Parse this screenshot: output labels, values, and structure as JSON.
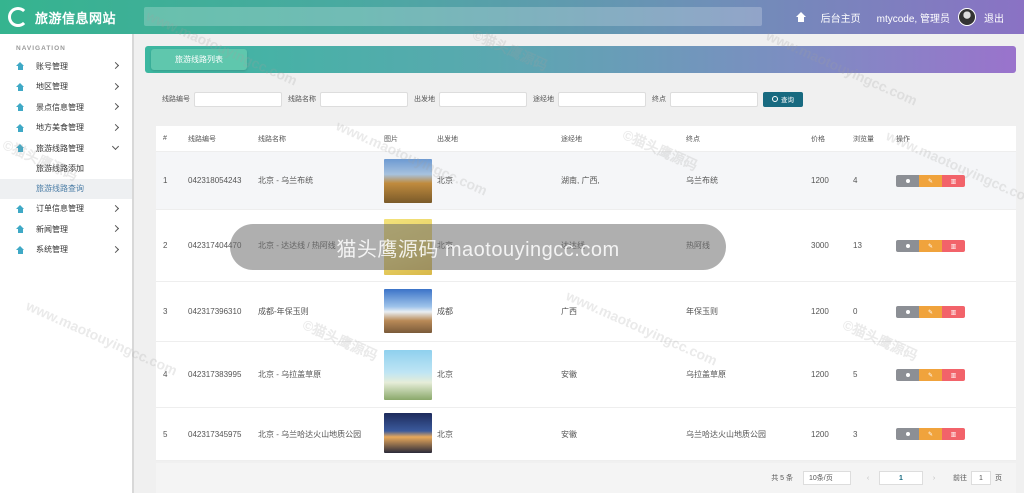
{
  "header": {
    "title": "旅游信息网站",
    "home_label": "后台主页",
    "user_label": "mtycode, 管理员",
    "logout_label": "退出"
  },
  "sidebar": {
    "nav_title": "NAVIGATION",
    "items": [
      {
        "label": "账号管理",
        "has_children": true
      },
      {
        "label": "地区管理",
        "has_children": true
      },
      {
        "label": "景点信息管理",
        "has_children": true
      },
      {
        "label": "地方美食管理",
        "has_children": true
      },
      {
        "label": "旅游线路管理",
        "has_children": true,
        "open": true
      }
    ],
    "sub_items": [
      {
        "label": "旅游线路添加",
        "active": false
      },
      {
        "label": "旅游线路查询",
        "active": true
      }
    ],
    "items_after": [
      {
        "label": "订单信息管理"
      },
      {
        "label": "新闻管理"
      },
      {
        "label": "系统管理"
      }
    ]
  },
  "tab": {
    "label": "旅游线路列表"
  },
  "search": {
    "fields": [
      "线路编号",
      "线路名称",
      "出发地",
      "途经地",
      "终点"
    ],
    "button_label": "查询"
  },
  "table": {
    "headers": [
      "#",
      "线路编号",
      "线路名称",
      "图片",
      "出发地",
      "途经地",
      "终点",
      "价格",
      "浏览量",
      "操作"
    ],
    "rows": [
      {
        "index": "1",
        "code": "042318054243",
        "name": "北京 - 乌兰布统",
        "from": "北京",
        "via": "湖南, 广西,",
        "to": "乌兰布统",
        "price": "1200",
        "views": "4"
      },
      {
        "index": "2",
        "code": "042317404470",
        "name": "北京 - 达达线 / 热阿线",
        "from": "北京",
        "via": "达达线",
        "to": "热阿线",
        "price": "3000",
        "views": "13"
      },
      {
        "index": "3",
        "code": "042317396310",
        "name": "成都-年保玉则",
        "from": "成都",
        "via": "广西",
        "to": "年保玉则",
        "price": "1200",
        "views": "0"
      },
      {
        "index": "4",
        "code": "042317383995",
        "name": "北京 - 乌拉盖草原",
        "from": "北京",
        "via": "安徽",
        "to": "乌拉盖草原",
        "price": "1200",
        "views": "5"
      },
      {
        "index": "5",
        "code": "042317345975",
        "name": "北京 - 乌兰哈达火山地质公园",
        "from": "北京",
        "via": "安徽",
        "to": "乌兰哈达火山地质公园",
        "price": "1200",
        "views": "3"
      }
    ]
  },
  "pager": {
    "total": "共 5 条",
    "page_size": "10条/页",
    "current": "1",
    "goto_label": "前往",
    "goto_value": "1",
    "page_unit": "页"
  },
  "watermark": {
    "overlay_text": "猫头鹰源码 maotouyingcc.com",
    "tile_text": "www.maotouyingcc.com",
    "tile_text_cn": "©猫头鹰源码"
  },
  "colors": {
    "accent": "#186a80",
    "op_view": "#8c8f95",
    "op_edit": "#f0a33c",
    "op_delete": "#f2636a"
  }
}
